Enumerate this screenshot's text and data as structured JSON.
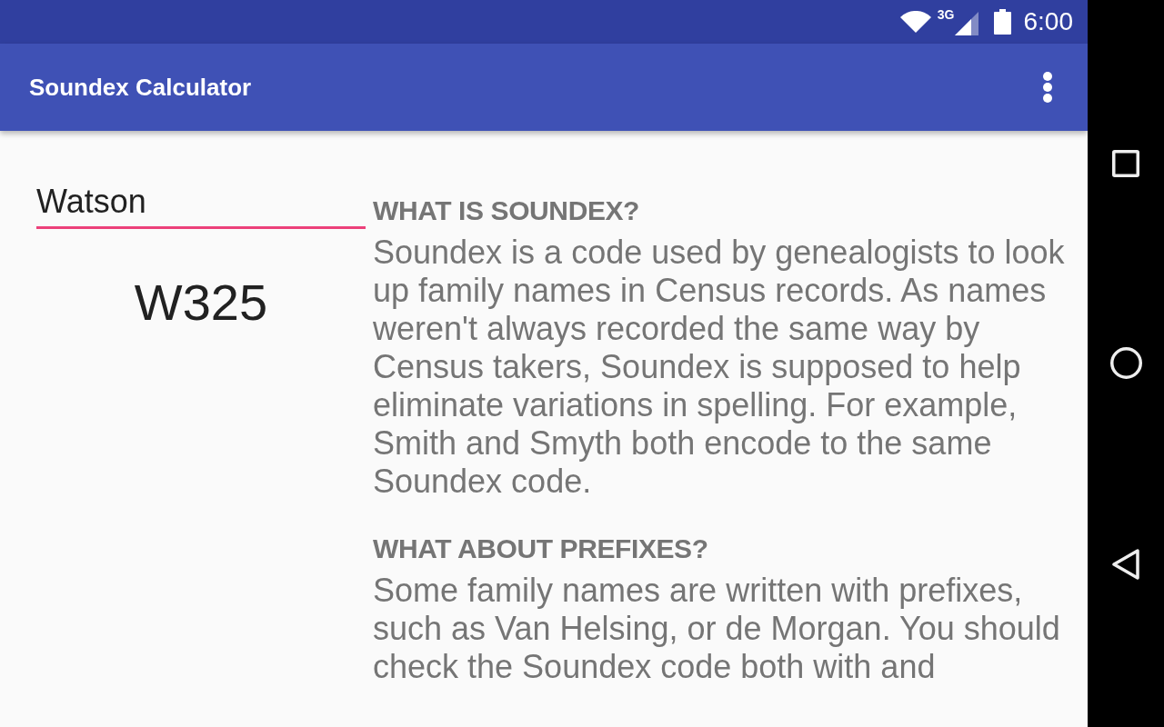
{
  "status_bar": {
    "network_type": "3G",
    "time": "6:00"
  },
  "app_bar": {
    "title": "Soundex Calculator"
  },
  "name_field": {
    "value": "Watson",
    "focused": true
  },
  "result": "W325",
  "sections": [
    {
      "heading": "WHAT IS SOUNDEX?",
      "body": "Soundex is a code used by genealogists to look up family names in Census records. As names weren't always recorded the same way by Census takers, Soundex is supposed to help eliminate variations in spelling. For example, Smith and Smyth both encode to the same Soundex code."
    },
    {
      "heading": "WHAT ABOUT PREFIXES?",
      "body": "Some family names are written with prefixes, such as Van Helsing, or de Morgan. You should check the Soundex code both with and"
    }
  ]
}
